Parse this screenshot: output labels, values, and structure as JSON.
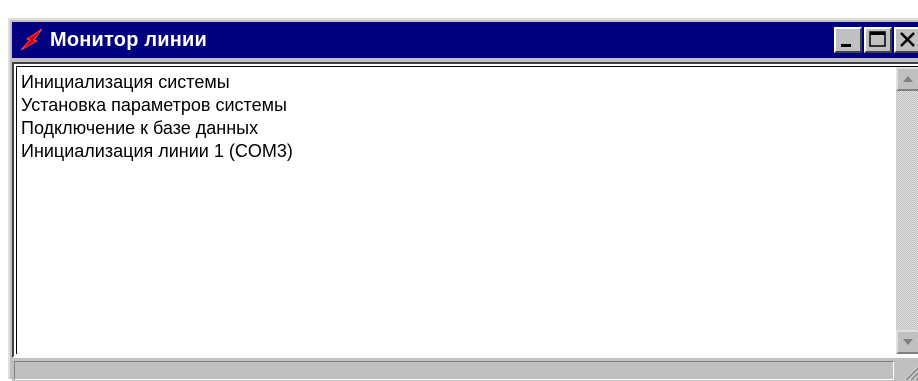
{
  "window": {
    "title": "Монитор линии",
    "icon": "lightning-icon",
    "buttons": [
      "minimize-icon",
      "maximize-icon",
      "close-icon"
    ],
    "colors": {
      "titlebar": "#000080",
      "face": "#c0c0c0",
      "icon_accent": "#cc0000"
    }
  },
  "log": {
    "lines": [
      "Инициализация системы",
      "Установка параметров системы",
      "Подключение к базе данных",
      "Инициализация линии 1 (COM3)"
    ]
  },
  "statusbar": {
    "text": ""
  }
}
